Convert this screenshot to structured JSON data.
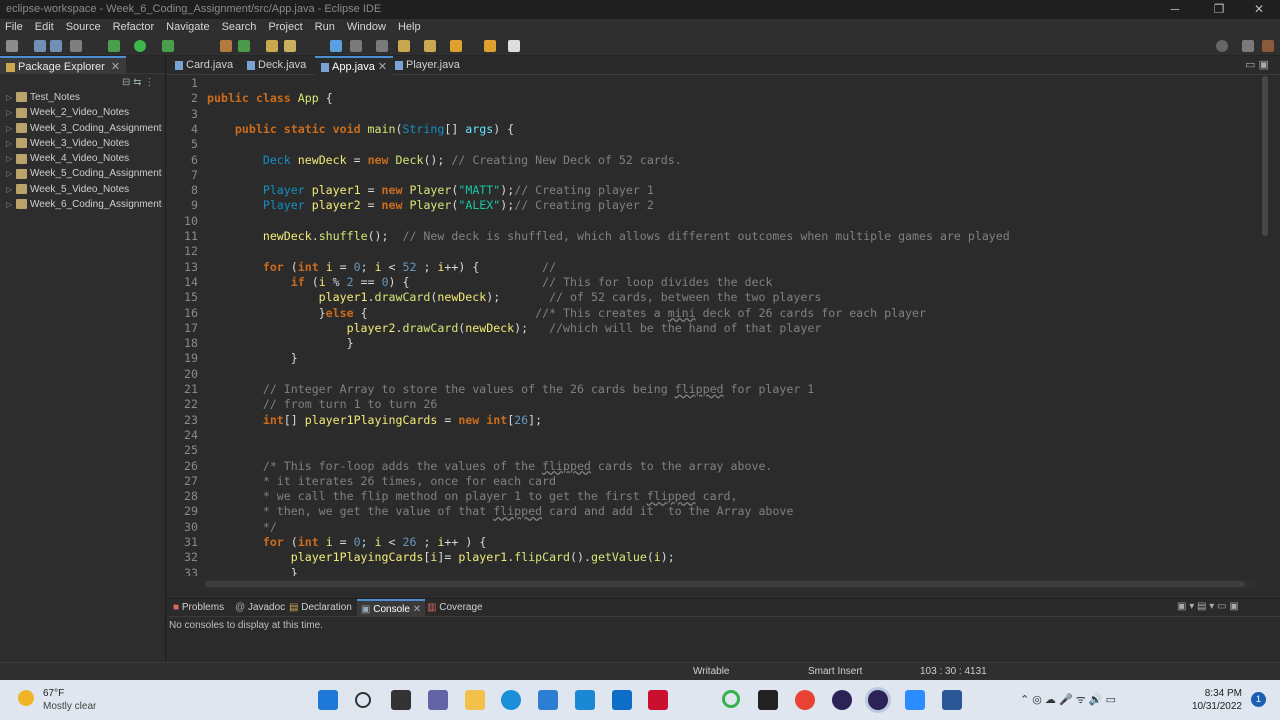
{
  "window": {
    "title": "eclipse-workspace - Week_6_Coding_Assignment/src/App.java - Eclipse IDE"
  },
  "menu": [
    "File",
    "Edit",
    "Source",
    "Refactor",
    "Navigate",
    "Search",
    "Project",
    "Run",
    "Window",
    "Help"
  ],
  "package_explorer": {
    "tab_label": "Package Explorer",
    "projects": [
      "Test_Notes",
      "Week_2_Video_Notes",
      "Week_3_Coding_Assignment",
      "Week_3_Video_Notes",
      "Week_4_Video_Notes",
      "Week_5_Coding_Assignment",
      "Week_5_Video_Notes",
      "Week_6_Coding_Assignment"
    ]
  },
  "editor": {
    "tabs": [
      "Card.java",
      "Deck.java",
      "App.java",
      "Player.java"
    ],
    "active_tab": "App.java"
  },
  "code_lines": [
    "1",
    "2",
    "3",
    "4",
    "5",
    "6",
    "7",
    "8",
    "9",
    "10",
    "11",
    "12",
    "13",
    "14",
    "15",
    "16",
    "17",
    "18",
    "19",
    "20",
    "21",
    "22",
    "23",
    "24",
    "25",
    "26",
    "27",
    "28",
    "29",
    "30",
    "31",
    "32",
    "33"
  ],
  "bottom_panel": {
    "tabs": [
      "Problems",
      "Javadoc",
      "Declaration",
      "Console",
      "Coverage"
    ],
    "active_tab": "Console",
    "console_message": "No consoles to display at this time."
  },
  "status_bar": {
    "mode": "Writable",
    "insert": "Smart Insert",
    "position": "103 : 30 : 4131"
  },
  "taskbar": {
    "weather_temp": "67°F",
    "weather_desc": "Mostly clear",
    "time": "8:34 PM",
    "date": "10/31/2022",
    "notification_count": "1"
  },
  "colors": {
    "accent": "#4b8fd1",
    "editor_bg": "#2b2b2b",
    "keyword": "#cc6c1d"
  }
}
